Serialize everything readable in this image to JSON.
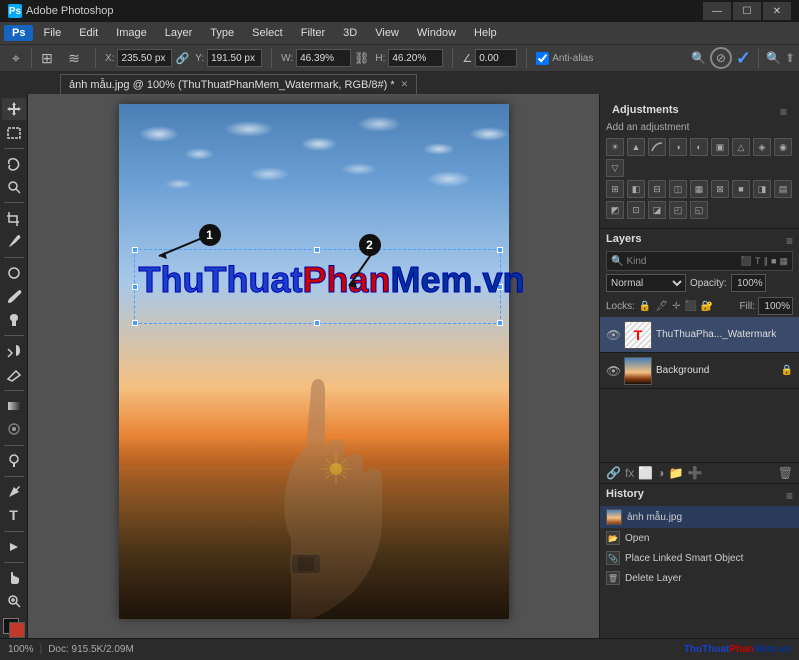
{
  "titlebar": {
    "title": "Adobe Photoshop",
    "minimize": "—",
    "maximize": "☐",
    "close": "✕"
  },
  "menubar": {
    "items": [
      "PS",
      "File",
      "Edit",
      "Image",
      "Layer",
      "Type",
      "Select",
      "Filter",
      "3D",
      "View",
      "Window",
      "Help"
    ]
  },
  "optionsbar": {
    "x_label": "X:",
    "x_value": "235.50 px",
    "y_label": "Y:",
    "y_value": "191.50 px",
    "w_label": "W:",
    "w_value": "46.39%",
    "h_label": "H:",
    "h_value": "46.20%",
    "angle_value": "0.00",
    "antialiased": "Anti-alias"
  },
  "tab": {
    "title": "ảnh mẫu.jpg @ 100% (ThuThuatPhanMem_Watermark, RGB/8#) *",
    "close": "✕"
  },
  "canvas": {
    "watermark_text": "ThuThuatPhanMem.vn",
    "watermark_blue": "ThuThuat",
    "watermark_red": "Phan",
    "watermark_blue2": "Mem.vn"
  },
  "adjustments": {
    "title": "Adjustments",
    "subtitle": "Add an adjustment",
    "icons": [
      "☀",
      "▲",
      "◑",
      "◐",
      "▣",
      "△",
      "◈",
      "◉",
      "■",
      "▤",
      "⊞",
      "◧",
      "⊟",
      "◫",
      "▦",
      "⊠",
      "◨",
      "◩",
      "⊡",
      "◪"
    ]
  },
  "layers": {
    "title": "Layers",
    "search_placeholder": "Kind",
    "mode": "Normal",
    "opacity_label": "Opacity:",
    "opacity_value": "100%",
    "lock_label": "Locks:",
    "fill_label": "Fill:",
    "fill_value": "100%",
    "items": [
      {
        "name": "ThuThuaPha..._Watermark",
        "visible": true,
        "type": "text",
        "locked": false
      },
      {
        "name": "Background",
        "visible": true,
        "type": "image",
        "locked": true
      }
    ]
  },
  "history": {
    "title": "History",
    "items": [
      {
        "label": "ảnh mẫu.jpg",
        "type": "file"
      },
      {
        "label": "Open",
        "type": "action"
      },
      {
        "label": "Place Linked Smart Object",
        "type": "action"
      },
      {
        "label": "Delete Layer",
        "type": "action"
      }
    ]
  },
  "statusbar": {
    "zoom": "100%",
    "doc_size": "Doc: 915.5K/2.09M",
    "brand": "ThuThuatPhanMem.vn"
  },
  "annotation1": "1",
  "annotation2": "2"
}
